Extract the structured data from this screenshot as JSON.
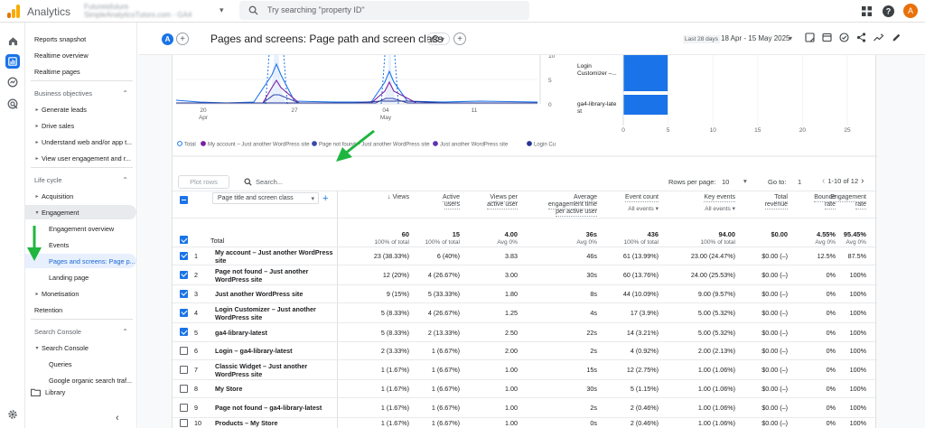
{
  "app": {
    "name": "Analytics",
    "account_line1": "Futureisfuture",
    "account_line2": "SimpleAnalyticsTutors.com - GA4"
  },
  "search": {
    "placeholder": "Try searching \"property ID\""
  },
  "user": {
    "avatar_letter": "A"
  },
  "sidebar": {
    "items": [
      {
        "label": "Reports snapshot",
        "type": "item"
      },
      {
        "label": "Realtime overview",
        "type": "item"
      },
      {
        "label": "Realtime pages",
        "type": "item"
      },
      {
        "label": "Business objectives",
        "type": "header"
      },
      {
        "label": "Generate leads",
        "type": "collapsed"
      },
      {
        "label": "Drive sales",
        "type": "collapsed"
      },
      {
        "label": "Understand web and/or app t...",
        "type": "collapsed"
      },
      {
        "label": "View user engagement and r...",
        "type": "collapsed"
      },
      {
        "label": "Life cycle",
        "type": "header"
      },
      {
        "label": "Acquisition",
        "type": "collapsed"
      },
      {
        "label": "Engagement",
        "type": "expanded"
      },
      {
        "label": "Engagement overview",
        "type": "sub"
      },
      {
        "label": "Events",
        "type": "sub"
      },
      {
        "label": "Pages and screens: Page p...",
        "type": "subsel"
      },
      {
        "label": "Landing page",
        "type": "sub"
      },
      {
        "label": "Monetisation",
        "type": "collapsed"
      },
      {
        "label": "Retention",
        "type": "item"
      },
      {
        "label": "Search Console",
        "type": "header"
      },
      {
        "label": "Search Console",
        "type": "expanded"
      },
      {
        "label": "Queries",
        "type": "sub"
      },
      {
        "label": "Google organic search traf...",
        "type": "sub"
      }
    ],
    "library": "Library"
  },
  "header": {
    "chip_letter": "A",
    "title": "Pages and screens: Page path and screen class",
    "date_label": "Last 28 days",
    "date_value": "18 Apr - 15 May 2025"
  },
  "chart_data": [
    {
      "type": "line",
      "x": [
        "20 Apr",
        "27",
        "04 May",
        "11"
      ],
      "x_ticks": [
        "20",
        "27",
        "04",
        "11"
      ],
      "x_subticks": [
        "Apr",
        "",
        "May",
        ""
      ],
      "y_right_ticks": [
        "10",
        "5",
        "0"
      ],
      "series": [
        {
          "name": "Total"
        },
        {
          "name": "My account – Just another WordPress site"
        },
        {
          "name": "Page not found – Just another WordPress site"
        },
        {
          "name": "Just another WordPress site"
        },
        {
          "name": "Login Cu"
        }
      ]
    },
    {
      "type": "bar",
      "categories": [
        "Login Customizer –...",
        "ga4-library-latest"
      ],
      "category_lines": [
        [
          "Login",
          "Customizer –..."
        ],
        [
          "ga4-library-late",
          "st"
        ]
      ],
      "values": [
        5,
        5
      ],
      "x_ticks": [
        "0",
        "5",
        "10",
        "15",
        "20",
        "25"
      ],
      "xlim": [
        0,
        25
      ]
    }
  ],
  "table": {
    "plot_rows": "Plot rows",
    "search_placeholder": "Search...",
    "rows_per_page_label": "Rows per page:",
    "rows_per_page": "10",
    "goto_label": "Go to:",
    "goto_value": "1",
    "range": "1-10 of 12",
    "dimension": "Page title and screen class",
    "columns": [
      {
        "l1": "↓ Views",
        "l2": "",
        "l3": "",
        "sub": ""
      },
      {
        "l1": "Active",
        "l2": "users",
        "l3": "",
        "sub": ""
      },
      {
        "l1": "Views per",
        "l2": "active user",
        "l3": "",
        "sub": ""
      },
      {
        "l1": "Average",
        "l2": "engagement time",
        "l3": "per active user",
        "sub": ""
      },
      {
        "l1": "Event count",
        "l2": "",
        "l3": "",
        "sub": "All events ▾"
      },
      {
        "l1": "Key events",
        "l2": "",
        "l3": "",
        "sub": "All events ▾"
      },
      {
        "l1": "Total",
        "l2": "revenue",
        "l3": "",
        "sub": ""
      },
      {
        "l1": "Bounce",
        "l2": "rate",
        "l3": "",
        "sub": ""
      },
      {
        "l1": "Engagement",
        "l2": "rate",
        "l3": "",
        "sub": ""
      }
    ],
    "totals": {
      "label": "Total",
      "values": [
        "60",
        "15",
        "4.00",
        "36s",
        "436",
        "94.00",
        "$0.00",
        "4.55%",
        "95.45%"
      ],
      "subs": [
        "100% of total",
        "100% of total",
        "Avg 0%",
        "Avg 0%",
        "100% of total",
        "100% of total",
        "",
        "Avg 0%",
        "Avg 0%"
      ]
    },
    "rows": [
      {
        "n": "1",
        "checked": true,
        "title": [
          "My account – Just another WordPress",
          "site"
        ],
        "values": [
          "23 (38.33%)",
          "6 (40%)",
          "3.83",
          "46s",
          "61 (13.99%)",
          "23.00 (24.47%)",
          "$0.00 (–)",
          "12.5%",
          "87.5%"
        ]
      },
      {
        "n": "2",
        "checked": true,
        "title": [
          "Page not found – Just another",
          "WordPress site"
        ],
        "values": [
          "12 (20%)",
          "4 (26.67%)",
          "3.00",
          "30s",
          "60 (13.76%)",
          "24.00 (25.53%)",
          "$0.00 (–)",
          "0%",
          "100%"
        ]
      },
      {
        "n": "3",
        "checked": true,
        "title": [
          "Just another WordPress site"
        ],
        "values": [
          "9 (15%)",
          "5 (33.33%)",
          "1.80",
          "8s",
          "44 (10.09%)",
          "9.00 (9.57%)",
          "$0.00 (–)",
          "0%",
          "100%"
        ]
      },
      {
        "n": "4",
        "checked": true,
        "title": [
          "Login Customizer – Just another",
          "WordPress site"
        ],
        "values": [
          "5 (8.33%)",
          "4 (26.67%)",
          "1.25",
          "4s",
          "17 (3.9%)",
          "5.00 (5.32%)",
          "$0.00 (–)",
          "0%",
          "100%"
        ]
      },
      {
        "n": "5",
        "checked": true,
        "title": [
          "ga4-library-latest"
        ],
        "values": [
          "5 (8.33%)",
          "2 (13.33%)",
          "2.50",
          "22s",
          "14 (3.21%)",
          "5.00 (5.32%)",
          "$0.00 (–)",
          "0%",
          "100%"
        ]
      },
      {
        "n": "6",
        "checked": false,
        "title": [
          "Login – ga4-library-latest"
        ],
        "values": [
          "2 (3.33%)",
          "1 (6.67%)",
          "2.00",
          "2s",
          "4 (0.92%)",
          "2.00 (2.13%)",
          "$0.00 (–)",
          "0%",
          "100%"
        ]
      },
      {
        "n": "7",
        "checked": false,
        "title": [
          "Classic Widget – Just another",
          "WordPress site"
        ],
        "values": [
          "1 (1.67%)",
          "1 (6.67%)",
          "1.00",
          "15s",
          "12 (2.75%)",
          "1.00 (1.06%)",
          "$0.00 (–)",
          "0%",
          "100%"
        ]
      },
      {
        "n": "8",
        "checked": false,
        "title": [
          "My Store"
        ],
        "values": [
          "1 (1.67%)",
          "1 (6.67%)",
          "1.00",
          "30s",
          "5 (1.15%)",
          "1.00 (1.06%)",
          "$0.00 (–)",
          "0%",
          "100%"
        ]
      },
      {
        "n": "9",
        "checked": false,
        "title": [
          "Page not found – ga4-library-latest"
        ],
        "values": [
          "1 (1.67%)",
          "1 (6.67%)",
          "1.00",
          "2s",
          "2 (0.46%)",
          "1.00 (1.06%)",
          "$0.00 (–)",
          "0%",
          "100%"
        ]
      },
      {
        "n": "10",
        "checked": false,
        "title": [
          "Products – My Store"
        ],
        "values": [
          "1 (1.67%)",
          "1 (6.67%)",
          "1.00",
          "0s",
          "2 (0.46%)",
          "1.00 (1.06%)",
          "$0.00 (–)",
          "0%",
          "100%"
        ]
      }
    ]
  },
  "colors": {
    "accent": "#1a73e8",
    "annotation_arrow": "#1fb53f",
    "logo_orange": "#f9ab00",
    "logo_dark": "#e37400"
  }
}
